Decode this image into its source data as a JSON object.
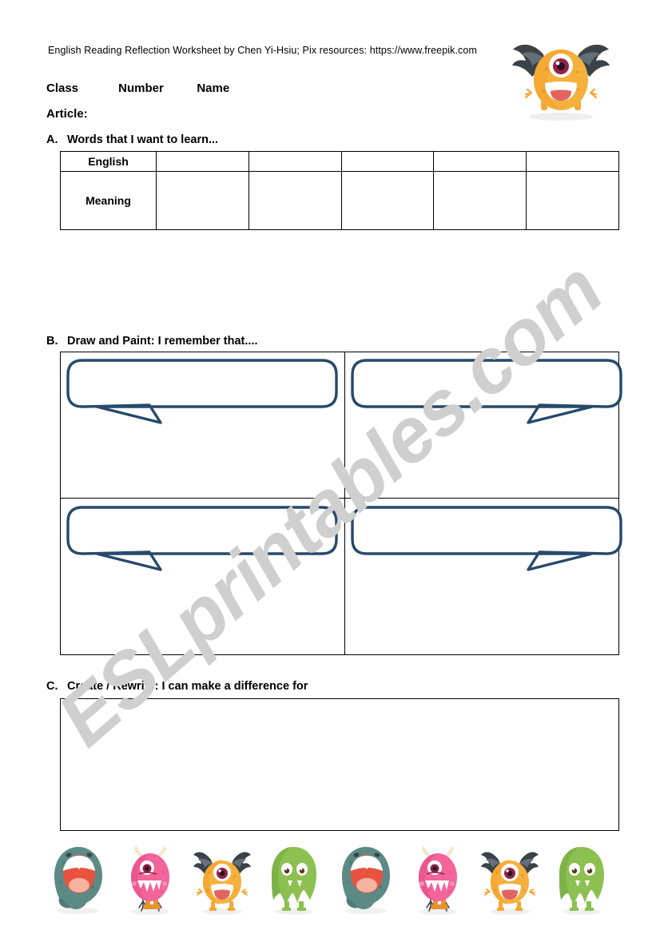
{
  "document": {
    "credit": "English Reading Reflection Worksheet by Chen Yi-Hsiu; Pix resources: https://www.freepik.com",
    "watermark": "ESLprintables.com"
  },
  "fields": {
    "class_label": "Class",
    "number_label": "Number",
    "name_label": "Name",
    "article_label": "Article:"
  },
  "sections": {
    "a": {
      "letter": "A.",
      "title": "Words that I want to learn...",
      "row_labels": [
        "English",
        "Meaning"
      ],
      "empty_columns": 5,
      "cells": {
        "english": [
          "",
          "",
          "",
          "",
          ""
        ],
        "meaning": [
          "",
          "",
          "",
          "",
          ""
        ]
      }
    },
    "b": {
      "letter": "B.",
      "title": "Draw and Paint: I remember that....",
      "panels": [
        {
          "id": "panel-1",
          "tail": "right",
          "caption": ""
        },
        {
          "id": "panel-2",
          "tail": "left",
          "caption": ""
        },
        {
          "id": "panel-3",
          "tail": "right",
          "caption": ""
        },
        {
          "id": "panel-4",
          "tail": "left",
          "caption": ""
        }
      ]
    },
    "c": {
      "letter": "C.",
      "title": "Create / Rewrite: I can make a difference for",
      "answer": ""
    }
  },
  "graphics": {
    "mascot_icon": "orange-winged-cyclops-monster-icon",
    "bubble_stroke_color": "#27496b",
    "monster_strip": [
      {
        "name": "teal-shouting-monster-icon",
        "body": "#5c8a85",
        "accent": "#e8533f"
      },
      {
        "name": "pink-horned-monster-icon",
        "body": "#f2649a",
        "accent": "#ffffff"
      },
      {
        "name": "orange-winged-monster-icon",
        "body": "#f5a833",
        "accent": "#3b4248"
      },
      {
        "name": "green-furry-monster-icon",
        "body": "#8cc152",
        "accent": "#ffffff"
      },
      {
        "name": "teal-shouting-monster-icon",
        "body": "#5c8a85",
        "accent": "#e8533f"
      },
      {
        "name": "pink-horned-monster-icon",
        "body": "#f2649a",
        "accent": "#ffffff"
      },
      {
        "name": "orange-winged-monster-icon",
        "body": "#f5a833",
        "accent": "#3b4248"
      },
      {
        "name": "green-furry-monster-icon",
        "body": "#8cc152",
        "accent": "#ffffff"
      }
    ]
  }
}
